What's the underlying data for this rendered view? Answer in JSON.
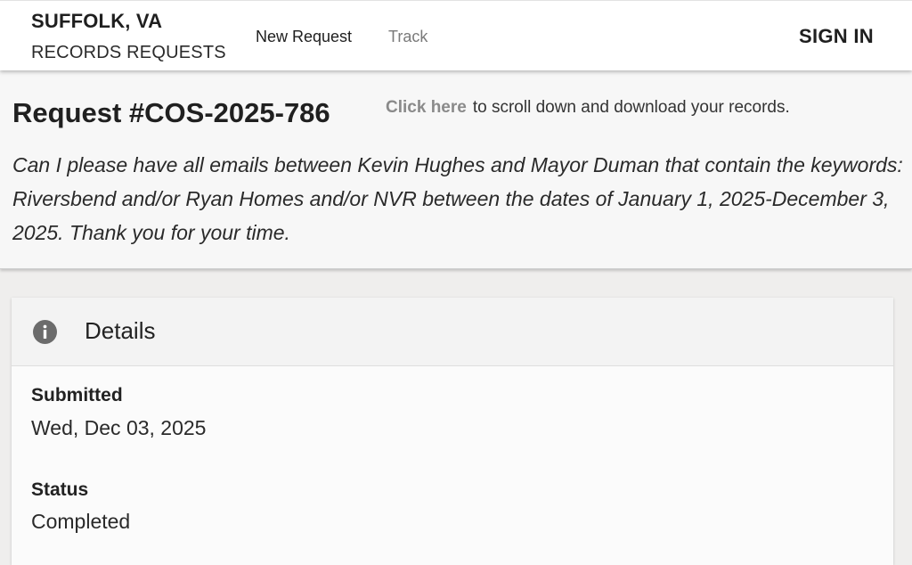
{
  "header": {
    "city": "SUFFOLK, VA",
    "subtitle": "RECORDS REQUESTS",
    "nav": {
      "new_request": "New Request",
      "track": "Track"
    },
    "sign_in": "SIGN IN"
  },
  "request": {
    "title": "Request #COS-2025-786",
    "click_here": "Click here",
    "click_suffix": "to scroll down and download your records.",
    "description": "Can I please have all emails between Kevin Hughes and Mayor Duman that contain the keywords: Riversbend and/or Ryan Homes and/or NVR between the dates of January 1, 2025-December 3, 2025. Thank you for your time."
  },
  "details": {
    "icon": "info-icon",
    "title": "Details",
    "submitted_label": "Submitted",
    "submitted_value": "Wed, Dec 03, 2025",
    "status_label": "Status",
    "status_value": "Completed"
  },
  "colors": {
    "link_gray": "#8a8a8a",
    "nav_inactive": "#7a7a7a",
    "page_bg": "#efeeed",
    "icon_fill": "#6b6b6b"
  }
}
